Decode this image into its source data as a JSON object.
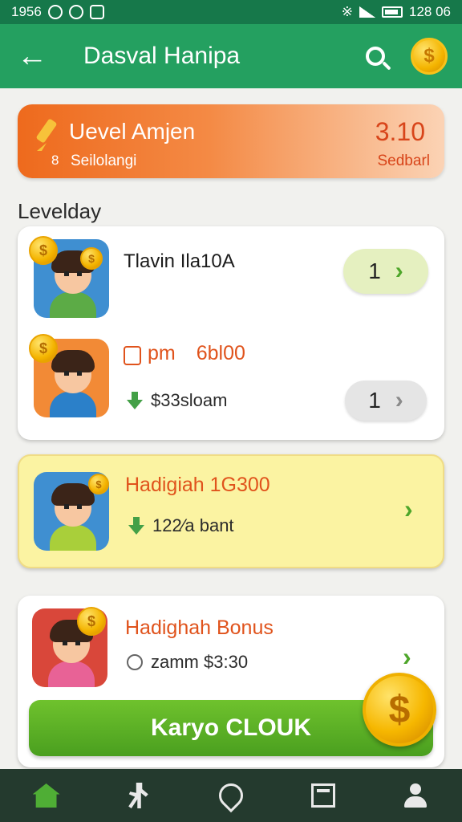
{
  "status_bar": {
    "time": "1956",
    "right_time": "128 06"
  },
  "app_bar": {
    "title": "Dasval Hanipa"
  },
  "banner": {
    "title": "Uevel Amjen",
    "subtitle": "Seilolangi",
    "sub_icon": "8",
    "value": "3.10",
    "value_label": "Sedbarl"
  },
  "section": {
    "label": "Levelday"
  },
  "card1": {
    "row1": {
      "title": "Tlavin Ila10A",
      "pill_count": "1"
    },
    "row2": {
      "prefix": "pm",
      "amount": "6bl00",
      "stat": "$33sloam",
      "pill_count": "1"
    }
  },
  "card2": {
    "title": "Hadigiah 1G300",
    "stat": "122⁄a bant"
  },
  "card3": {
    "title": "Hadighah Bonus",
    "stat": "zamm $3:30",
    "button": "Karyo CLOUK"
  },
  "icons": {
    "back": "←",
    "coin": "$",
    "chevron": "›"
  },
  "colors": {
    "primary_green": "#24a060",
    "dark_green": "#16784a",
    "accent_orange": "#ee6a1d",
    "yellow_card": "#fbf3a2",
    "button_green": "#5bb127",
    "nav_bg": "#243a2e"
  }
}
